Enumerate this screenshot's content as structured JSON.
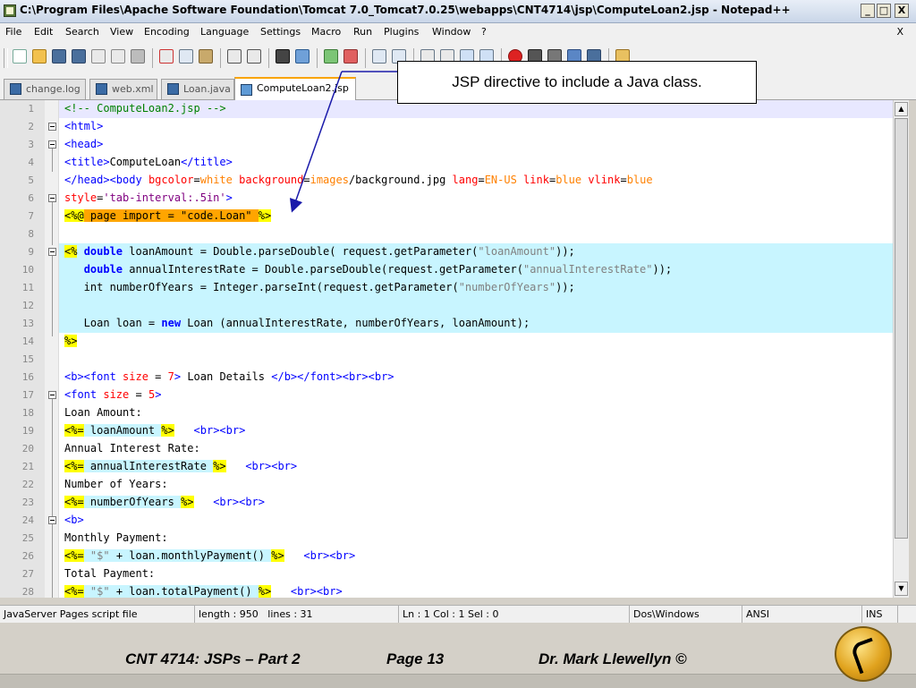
{
  "window": {
    "title": "C:\\Program Files\\Apache Software Foundation\\Tomcat 7.0_Tomcat7.0.25\\webapps\\CNT4714\\jsp\\ComputeLoan2.jsp - Notepad++",
    "buttons": {
      "minimize": "_",
      "maximize": "□",
      "close": "X"
    }
  },
  "menubar": {
    "items": [
      "File",
      "Edit",
      "Search",
      "View",
      "Encoding",
      "Language",
      "Settings",
      "Macro",
      "Run",
      "Plugins",
      "Window",
      "?"
    ],
    "close_x": "X"
  },
  "tabs": [
    {
      "label": "change.log",
      "active": false
    },
    {
      "label": "web.xml",
      "active": false
    },
    {
      "label": "Loan.java",
      "active": false
    },
    {
      "label": "ComputeLoan2.jsp",
      "active": true
    }
  ],
  "callout": {
    "text": "JSP directive to include a Java class."
  },
  "editor": {
    "line_numbers": [
      "1",
      "2",
      "3",
      "4",
      "5",
      "6",
      "7",
      "8",
      "9",
      "10",
      "11",
      "12",
      "13",
      "14",
      "15",
      "16",
      "17",
      "18",
      "19",
      "20",
      "21",
      "22",
      "23",
      "24",
      "25",
      "26",
      "27",
      "28"
    ]
  },
  "statusbar": {
    "file_type": "JavaServer Pages script file",
    "length": "length : 950",
    "lines": "lines : 31",
    "position": "Ln : 1    Col : 1    Sel : 0",
    "eol": "Dos\\Windows",
    "encoding": "ANSI",
    "mode": "INS"
  },
  "footer": {
    "course": "CNT 4714: JSPs – Part 2",
    "page": "Page 13",
    "author": "Dr. Mark Llewellyn ©"
  },
  "colors": {
    "jsp_highlight": "#ffff00",
    "directive_highlight": "#ffa500",
    "scriptlet_background": "#ccf5ff",
    "tag_blue": "#0000ff",
    "attr_red": "#ff0000"
  }
}
